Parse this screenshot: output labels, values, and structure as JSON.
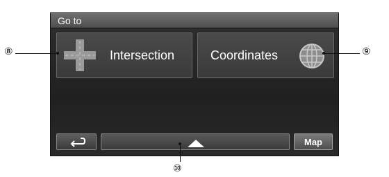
{
  "screen": {
    "title": "Go to",
    "options": [
      {
        "label": "Intersection",
        "icon": "cross-icon"
      },
      {
        "label": "Coordinates",
        "icon": "globe-icon"
      }
    ]
  },
  "bottom_bar": {
    "back_icon": "back-arrow-icon",
    "scroll_icon": "triangle-up-icon",
    "map_label": "Map"
  },
  "callouts": {
    "intersection": "⑧",
    "coordinates": "⑨",
    "scroll": "⑩"
  }
}
